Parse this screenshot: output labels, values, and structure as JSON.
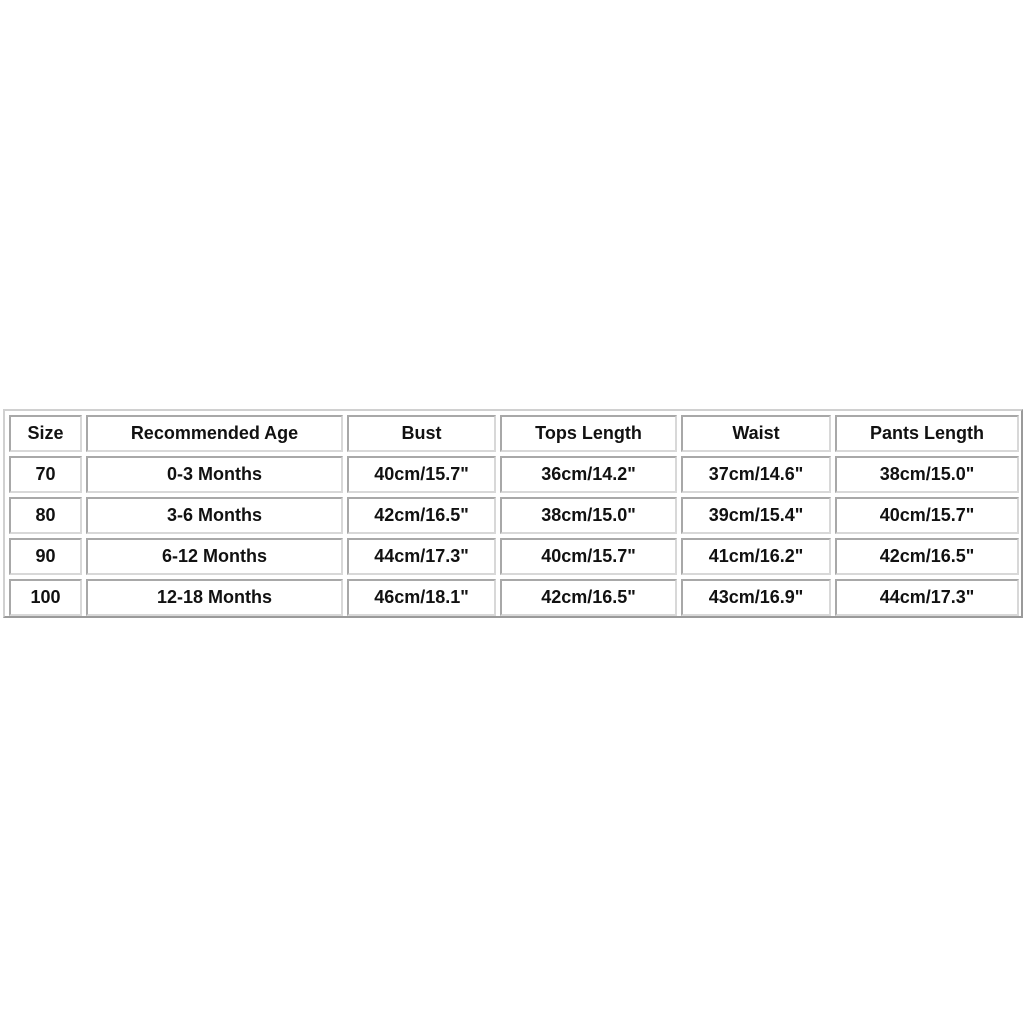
{
  "size_chart": {
    "headers": [
      "Size",
      "Recommended Age",
      "Bust",
      "Tops Length",
      "Waist",
      "Pants Length"
    ],
    "rows": [
      [
        "70",
        "0-3 Months",
        "40cm/15.7\"",
        "36cm/14.2\"",
        "37cm/14.6\"",
        "38cm/15.0\""
      ],
      [
        "80",
        "3-6 Months",
        "42cm/16.5\"",
        "38cm/15.0\"",
        "39cm/15.4\"",
        "40cm/15.7\""
      ],
      [
        "90",
        "6-12 Months",
        "44cm/17.3\"",
        "40cm/15.7\"",
        "41cm/16.2\"",
        "42cm/16.5\""
      ],
      [
        "100",
        "12-18 Months",
        "46cm/18.1\"",
        "42cm/16.5\"",
        "43cm/16.9\"",
        "44cm/17.3\""
      ]
    ]
  }
}
